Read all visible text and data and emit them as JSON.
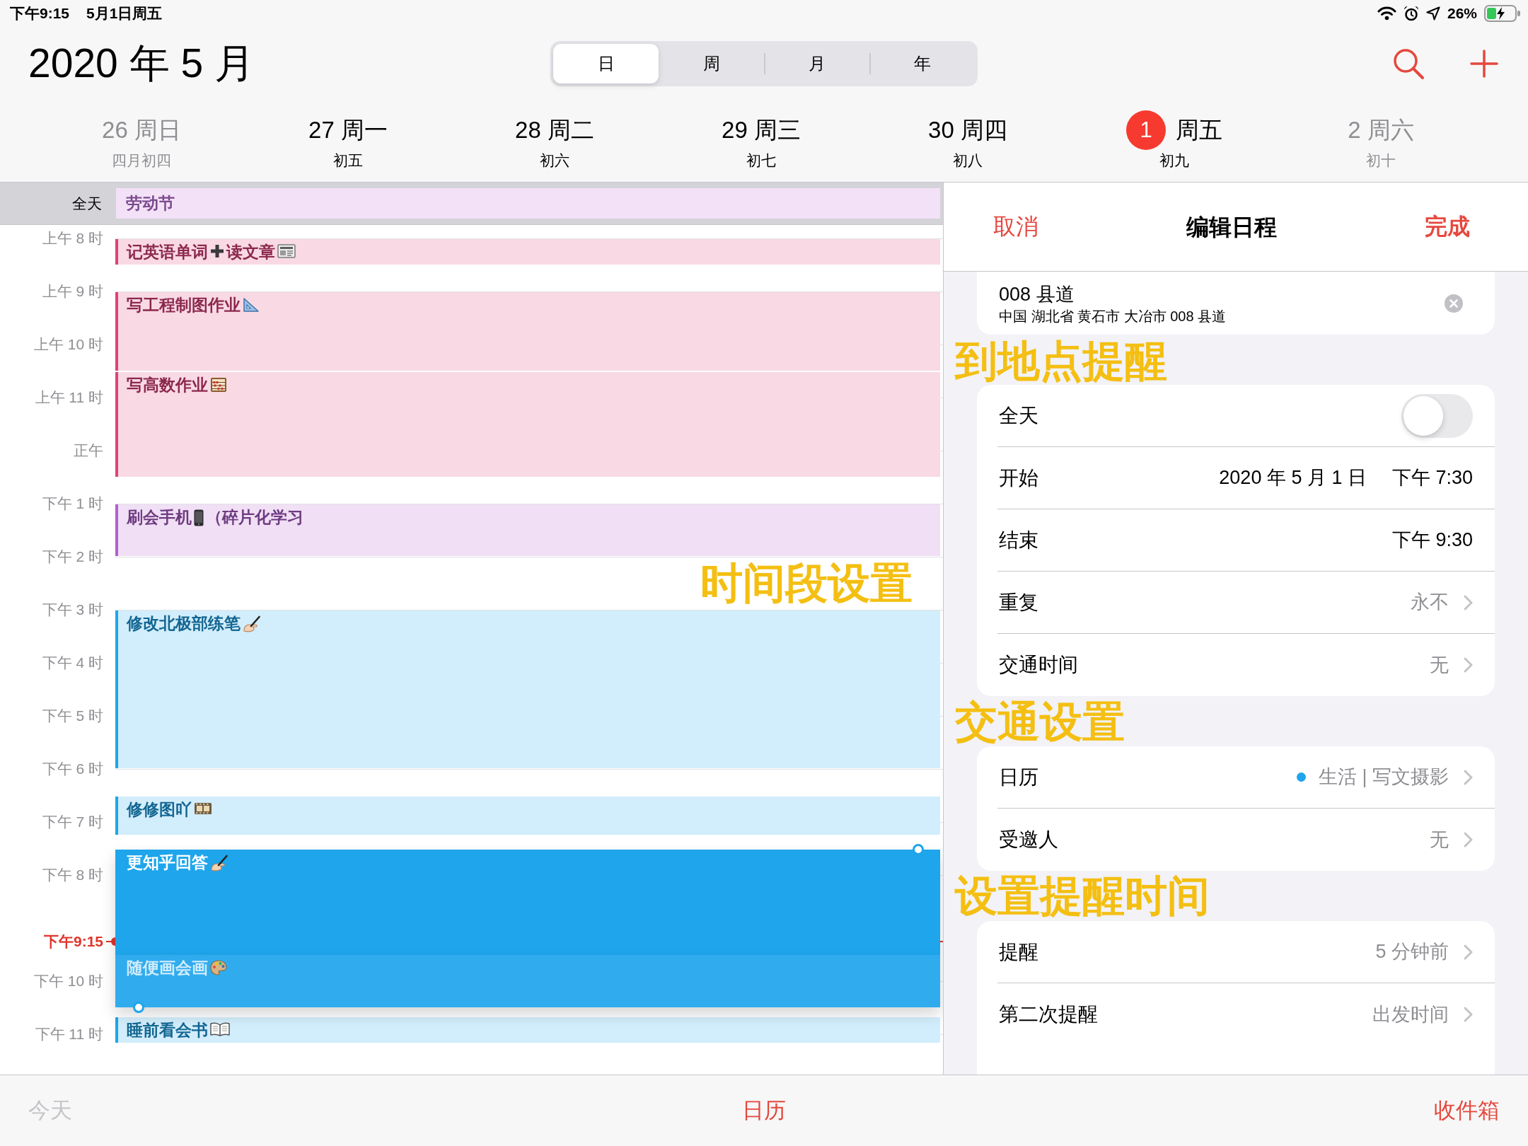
{
  "status_bar": {
    "time": "下午9:15",
    "date": "5月1日周五",
    "battery": "26%"
  },
  "header": {
    "title": "2020 年 5 月",
    "views": [
      {
        "label": "日",
        "selected": true
      },
      {
        "label": "周",
        "selected": false
      },
      {
        "label": "月",
        "selected": false
      },
      {
        "label": "年",
        "selected": false
      }
    ]
  },
  "days": [
    {
      "date": "26",
      "weekday": "周日",
      "lunar": "四月初四",
      "dimmed": true,
      "today": false
    },
    {
      "date": "27",
      "weekday": "周一",
      "lunar": "初五",
      "dimmed": false,
      "today": false
    },
    {
      "date": "28",
      "weekday": "周二",
      "lunar": "初六",
      "dimmed": false,
      "today": false
    },
    {
      "date": "29",
      "weekday": "周三",
      "lunar": "初七",
      "dimmed": false,
      "today": false
    },
    {
      "date": "30",
      "weekday": "周四",
      "lunar": "初八",
      "dimmed": false,
      "today": false
    },
    {
      "date": "1",
      "weekday": "周五",
      "lunar": "初九",
      "dimmed": false,
      "today": true
    },
    {
      "date": "2",
      "weekday": "周六",
      "lunar": "初十",
      "dimmed": true,
      "today": false
    }
  ],
  "all_day": {
    "label": "全天",
    "events": [
      {
        "title": "劳动节",
        "color": "#f3e1f8"
      }
    ]
  },
  "timeline": {
    "hours": [
      "上午 8 时",
      "上午 9 时",
      "上午 10 时",
      "上午 11 时",
      "正午",
      "下午 1 时",
      "下午 2 时",
      "下午 3 时",
      "下午 4 时",
      "下午 5 时",
      "下午 6 时",
      "下午 7 时",
      "下午 8 时",
      "下午 10 时",
      "下午 11 时"
    ],
    "now": {
      "label": "下午9:15"
    },
    "events": [
      {
        "parts": [
          {
            "kind": "text",
            "text": "记英语单词"
          },
          {
            "kind": "icon"
          },
          {
            "kind": "text",
            "text": "读文章"
          },
          {
            "kind": "icon"
          }
        ],
        "color": "#e0407a",
        "selected": false,
        "dimmed": false
      },
      {
        "parts": [
          {
            "kind": "text",
            "text": "写工程制图作业"
          },
          {
            "kind": "icon"
          }
        ],
        "color": "#e0407a",
        "selected": false,
        "dimmed": false
      },
      {
        "parts": [
          {
            "kind": "text",
            "text": "写高数作业"
          },
          {
            "kind": "icon"
          }
        ],
        "color": "#e0407a",
        "selected": false,
        "dimmed": false
      },
      {
        "parts": [
          {
            "kind": "text",
            "text": "刷会手机"
          },
          {
            "kind": "icon"
          },
          {
            "kind": "text",
            "text": "（碎片化学习"
          }
        ],
        "color": "#b25fcf",
        "selected": false,
        "dimmed": false
      },
      {
        "parts": [
          {
            "kind": "text",
            "text": "修改北极部练笔"
          },
          {
            "kind": "icon"
          }
        ],
        "color": "#1ea5ec",
        "selected": false,
        "dimmed": false
      },
      {
        "parts": [
          {
            "kind": "text",
            "text": "修修图吖"
          },
          {
            "kind": "icon"
          }
        ],
        "color": "#1ea5ec",
        "selected": false,
        "dimmed": false
      },
      {
        "parts": [
          {
            "kind": "text",
            "text": "更知乎回答"
          },
          {
            "kind": "icon"
          }
        ],
        "color": "#1ea5ec",
        "selected": true,
        "dimmed": false
      },
      {
        "parts": [
          {
            "kind": "text",
            "text": "随便画会画"
          },
          {
            "kind": "icon"
          }
        ],
        "color": "#1ea5ec",
        "selected": false,
        "dimmed": true
      },
      {
        "parts": [
          {
            "kind": "text",
            "text": "睡前看会书"
          },
          {
            "kind": "icon"
          }
        ],
        "color": "#1ea5ec",
        "selected": false,
        "dimmed": false
      }
    ]
  },
  "editor": {
    "cancel": "取消",
    "title": "编辑日程",
    "done": "完成",
    "location": {
      "name": "008 县道",
      "address": "中国 湖北省 黄石市 大冶市 008 县道"
    },
    "groups": [
      {
        "rows": [
          {
            "kind": "toggle",
            "label": "全天",
            "on": false
          },
          {
            "kind": "datetime",
            "label": "开始",
            "date": "2020 年 5 月 1 日",
            "time": "下午 7:30"
          },
          {
            "kind": "datetime",
            "label": "结束",
            "time": "下午 9:30"
          },
          {
            "kind": "link",
            "label": "重复",
            "value": "永不"
          },
          {
            "kind": "link",
            "label": "交通时间",
            "value": "无"
          }
        ]
      },
      {
        "rows": [
          {
            "kind": "calendar",
            "label": "日历",
            "value": "生活 | 写文摄影",
            "color": "#1ea5ec"
          },
          {
            "kind": "link",
            "label": "受邀人",
            "value": "无"
          }
        ]
      },
      {
        "rows": [
          {
            "kind": "link",
            "label": "提醒",
            "value": "5 分钟前"
          },
          {
            "kind": "link",
            "label": "第二次提醒",
            "value": "出发时间"
          }
        ]
      }
    ]
  },
  "toolbar": [
    {
      "label": "今天",
      "disabled": true
    },
    {
      "label": "日历",
      "disabled": false
    },
    {
      "label": "收件箱",
      "disabled": false
    }
  ],
  "annotations": [
    "到地点提醒",
    "时间段设置",
    "交通设置",
    "设置提醒时间"
  ]
}
